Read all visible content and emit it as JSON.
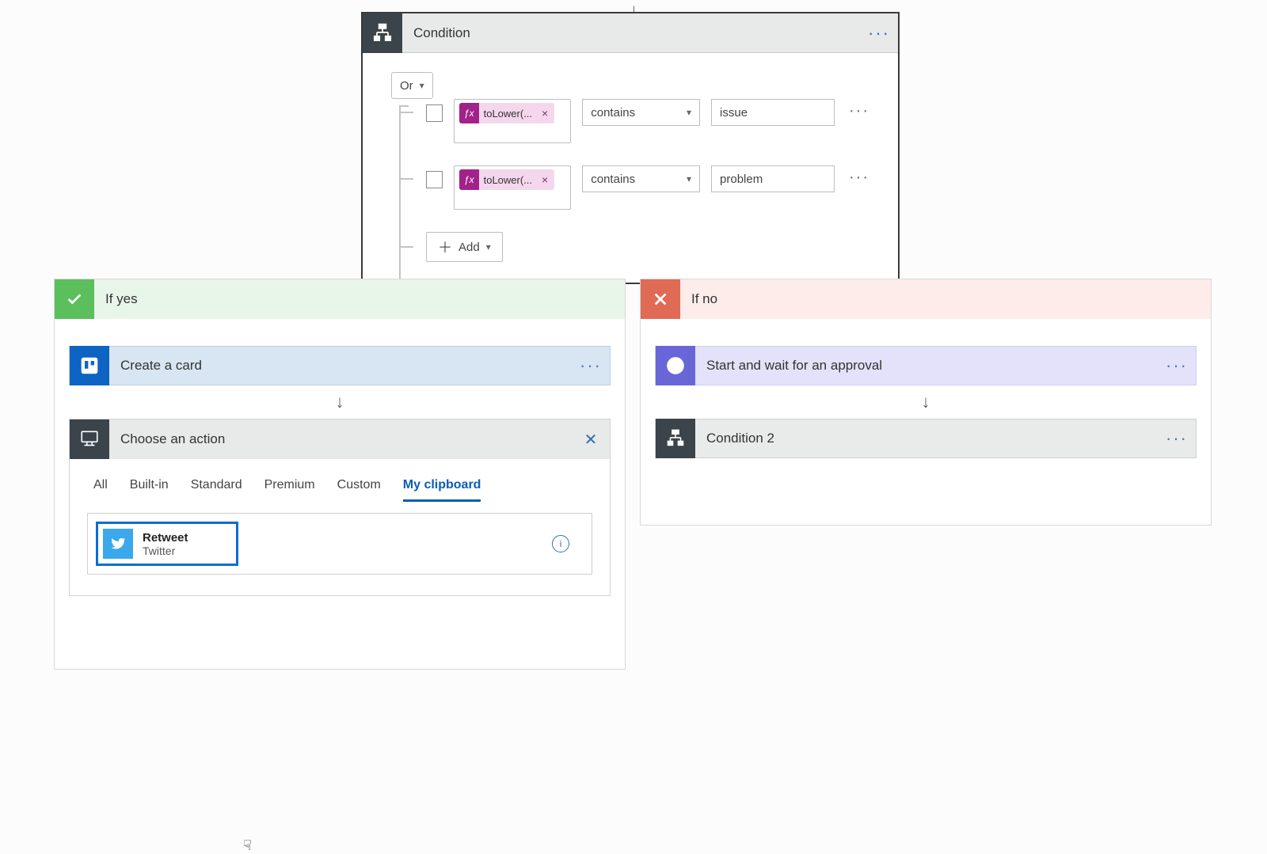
{
  "condition": {
    "title": "Condition",
    "group_op": "Or",
    "rows": [
      {
        "fx": "toLower(...",
        "operator": "contains",
        "value": "issue"
      },
      {
        "fx": "toLower(...",
        "operator": "contains",
        "value": "problem"
      }
    ],
    "add_label": "Add"
  },
  "branches": {
    "yes": {
      "label": "If yes",
      "actions": [
        {
          "title": "Create a card"
        }
      ],
      "choose": {
        "title": "Choose an action",
        "tabs": [
          "All",
          "Built-in",
          "Standard",
          "Premium",
          "Custom",
          "My clipboard"
        ],
        "active_tab": "My clipboard",
        "clipboard_item": {
          "name": "Retweet",
          "connector": "Twitter"
        }
      }
    },
    "no": {
      "label": "If no",
      "actions": [
        {
          "title": "Start and wait for an approval"
        },
        {
          "title": "Condition 2"
        }
      ]
    }
  }
}
